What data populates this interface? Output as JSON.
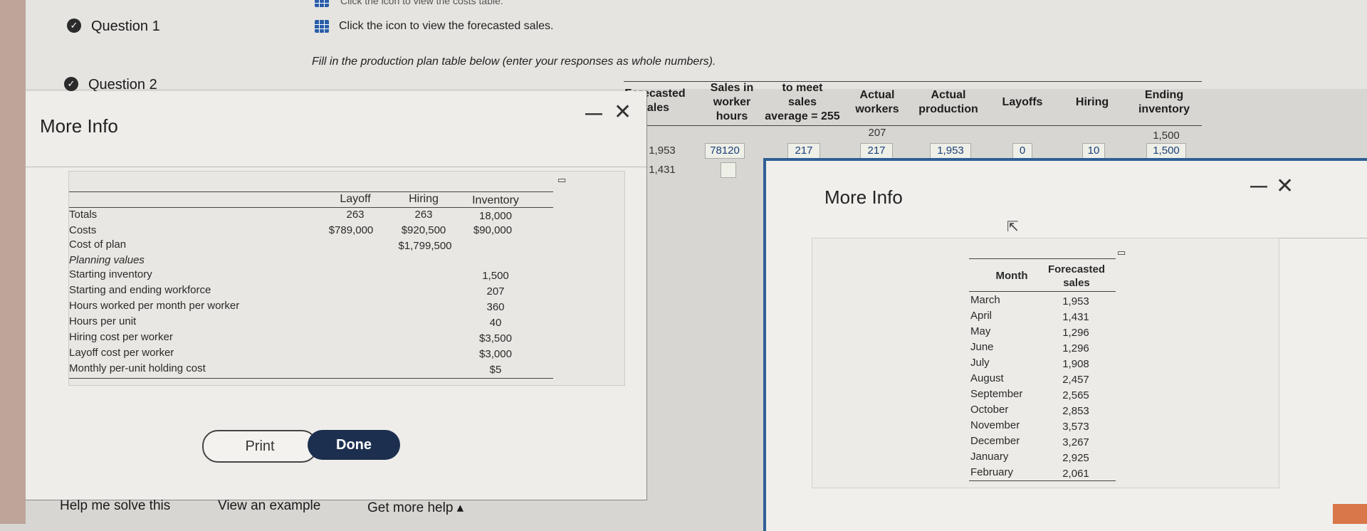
{
  "top": {
    "costs_hint": "Click the icon to view the costs table.",
    "question1": "Question 1",
    "question2": "Question 2",
    "sales_hint": "Click the icon to view the forecasted sales.",
    "instruction": "Fill in the production plan table below (enter your responses as whole numbers)."
  },
  "plan_table": {
    "headers": {
      "forecasted_sales": [
        "Forecasted",
        "sales"
      ],
      "sales_in_worker_hours": [
        "Sales in",
        "worker",
        "hours"
      ],
      "to_meet_sales": [
        "to meet",
        "sales",
        "average = 255"
      ],
      "actual_workers": [
        "Actual",
        "workers"
      ],
      "actual_production": [
        "Actual",
        "production"
      ],
      "layoffs": "Layoffs",
      "hiring": "Hiring",
      "ending_inventory": [
        "Ending",
        "inventory"
      ]
    },
    "initial_row": {
      "actual_workers": "207",
      "ending_inventory": "1,500"
    },
    "row1": {
      "forecasted_sales": "1,953",
      "sales_in_worker_hours": "78120",
      "to_meet_sales": "217",
      "actual_workers": "217",
      "actual_production": "1,953",
      "layoffs": "0",
      "hiring": "10",
      "ending_inventory": "1,500"
    },
    "row2": {
      "forecasted_sales": "1,431",
      "sales_in_worker_hours": ""
    }
  },
  "more_info_left": {
    "title": "More Info",
    "columns": [
      "Layoff",
      "Hiring",
      "Inventory"
    ],
    "rows": [
      {
        "label": "Totals",
        "layoff": "263",
        "hiring": "263",
        "inventory": "18,000"
      },
      {
        "label": "Costs",
        "layoff": "$789,000",
        "hiring": "$920,500",
        "inventory": "$90,000"
      },
      {
        "label": "Cost of plan",
        "layoff": "",
        "hiring": "$1,799,500",
        "inventory": ""
      }
    ],
    "planning_values_label": "Planning values",
    "planning_values": [
      {
        "label": "Starting inventory",
        "value": "1,500"
      },
      {
        "label": "Starting and ending workforce",
        "value": "207"
      },
      {
        "label": "Hours worked per month per worker",
        "value": "360"
      },
      {
        "label": "Hours per unit",
        "value": "40"
      },
      {
        "label": "Hiring cost per worker",
        "value": "$3,500"
      },
      {
        "label": "Layoff cost per worker",
        "value": "$3,000"
      },
      {
        "label": "Monthly per-unit holding cost",
        "value": "$5"
      }
    ],
    "print_label": "Print",
    "done_label": "Done"
  },
  "help_bar": {
    "help_me": "Help me solve this",
    "example": "View an example",
    "more_help": "Get more help ▴"
  },
  "more_info_right": {
    "title": "More Info",
    "columns": {
      "month": "Month",
      "sales": [
        "Forecasted",
        "sales"
      ]
    },
    "rows": [
      {
        "month": "March",
        "sales": "1,953"
      },
      {
        "month": "April",
        "sales": "1,431"
      },
      {
        "month": "May",
        "sales": "1,296"
      },
      {
        "month": "June",
        "sales": "1,296"
      },
      {
        "month": "July",
        "sales": "1,908"
      },
      {
        "month": "August",
        "sales": "2,457"
      },
      {
        "month": "September",
        "sales": "2,565"
      },
      {
        "month": "October",
        "sales": "2,853"
      },
      {
        "month": "November",
        "sales": "3,573"
      },
      {
        "month": "December",
        "sales": "3,267"
      },
      {
        "month": "January",
        "sales": "2,925"
      },
      {
        "month": "February",
        "sales": "2,061"
      }
    ]
  },
  "icons": {
    "check": "check-circle-icon",
    "table": "table-icon",
    "close": "close-icon",
    "minimize": "minimize-icon",
    "copy": "copy-icon",
    "cursor": "mouse-cursor-icon"
  }
}
